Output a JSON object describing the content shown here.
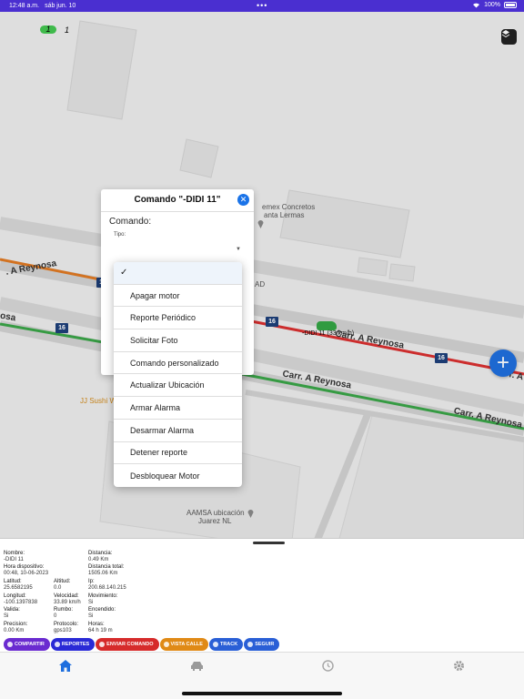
{
  "status_bar": {
    "time": "12:48 a.m.",
    "date": "sáb jun. 10",
    "dots": "•••",
    "battery": "100%"
  },
  "map": {
    "counter_active": "1",
    "counter_total": "1",
    "labels": {
      "place_concretos": "emex Concretos",
      "place_santa": "anta Lermas",
      "place_ad": "AD",
      "place_sushi": "JJ Sushi W",
      "place_aamsa_1": "AAMSA ubicación",
      "place_aamsa_2": "Juarez NL"
    },
    "roads": {
      "reynosa_left": ". A Reynosa",
      "osa": "osa",
      "reynosa_mid": "Carr. A Reynosa",
      "reynosa_red": "Carr. A Reynosa",
      "reynosa_right": "Carr. A Reynosa",
      "reynosa_edge": "Carr. A"
    },
    "shield_number": "16",
    "vehicle_label": "-DIDI 11 (33 km/h)",
    "colors": {
      "red_road": "#d93030",
      "green_road": "#3aa548",
      "orange_road": "#e07a24",
      "fab": "#1f6fde"
    }
  },
  "dialog": {
    "title": "Comando \"-DIDI 11\"",
    "command_label": "Comando:",
    "type_label": "Tipo:"
  },
  "dropdown": {
    "selected_check": "✓",
    "items": [
      "Apagar motor",
      "Reporte Periódico",
      "Solicitar Foto",
      "Comando personalizado",
      "Actualizar Ubicación",
      "Armar Alarma",
      "Desarmar Alarma",
      "Detener reporte",
      "Desbloquear Motor"
    ]
  },
  "info": {
    "nombre_label": "Nombre:",
    "nombre": "-DIDI 11",
    "hora_label": "Hora dispositivo:",
    "hora": "00:48, 10-06-2023",
    "latitud_label": "Latitud:",
    "latitud": "25.6582195",
    "altitud_label": "Altitud:",
    "altitud": "0.0",
    "longitud_label": "Longitud:",
    "longitud": "-100.1397838",
    "velocidad_label": "Velocidad:",
    "velocidad": "33.89 km/h",
    "valida_label": "Valida:",
    "valida": "Si",
    "rumbo_label": "Rumbo:",
    "rumbo": "0",
    "precision_label": "Precision:",
    "precision": "0.00 Km",
    "protocolo_label": "Protocolo:",
    "protocolo": "gps103",
    "distancia_label": "Distancia:",
    "distancia": "0.49 Km",
    "distancia_total_label": "Distancia total:",
    "distancia_total": "1505.06 Km",
    "ip_label": "Ip:",
    "ip": "200.68.140.215",
    "movimiento_label": "Movimiento:",
    "movimiento": "Si",
    "encendido_label": "Encendido:",
    "encendido": "Si",
    "horas_label": "Horas:",
    "horas": "64 h 19 m"
  },
  "actions": {
    "compartir": "COMPARTIR",
    "reportes": "REPORTES",
    "enviar": "ENVIAR COMANDO",
    "vista": "VISTA CALLE",
    "track": "TRACK",
    "seguir": "SEGUIR",
    "colors": {
      "compartir": "#6a2bd0",
      "reportes": "#2a2ad6",
      "enviar": "#d62b2b",
      "vista": "#e08a16",
      "track": "#2a5fd6",
      "seguir": "#2a5fd6"
    }
  },
  "tabs": {
    "home_icon": "home-icon",
    "car_icon": "car-icon",
    "history_icon": "history-icon",
    "settings_icon": "gear-icon"
  }
}
